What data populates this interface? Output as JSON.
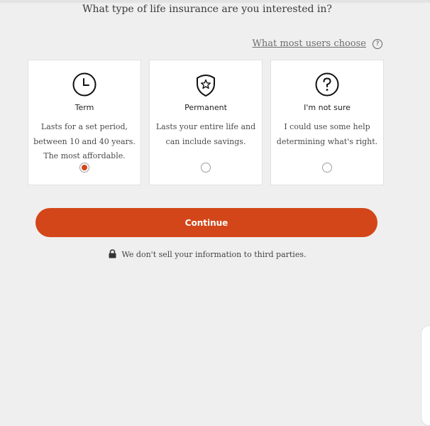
{
  "question": "What type of life insurance are you interested in?",
  "help": {
    "link_text": "What most users choose",
    "icon": "question-circle-icon"
  },
  "options": [
    {
      "title": "Term",
      "description": "Lasts for a set period, between 10 and 40 years. The most affordable.",
      "icon": "clock-icon",
      "selected": true
    },
    {
      "title": "Permanent",
      "description": "Lasts your entire life and can include savings.",
      "icon": "shield-star-icon",
      "selected": false
    },
    {
      "title": "I'm not sure",
      "description": "I could use some help determining what's right.",
      "icon": "question-circle-icon",
      "selected": false
    }
  ],
  "continue_label": "Continue",
  "privacy_note": "We don't sell your information to third parties.",
  "colors": {
    "accent": "#d34619",
    "background": "#f0efef"
  }
}
